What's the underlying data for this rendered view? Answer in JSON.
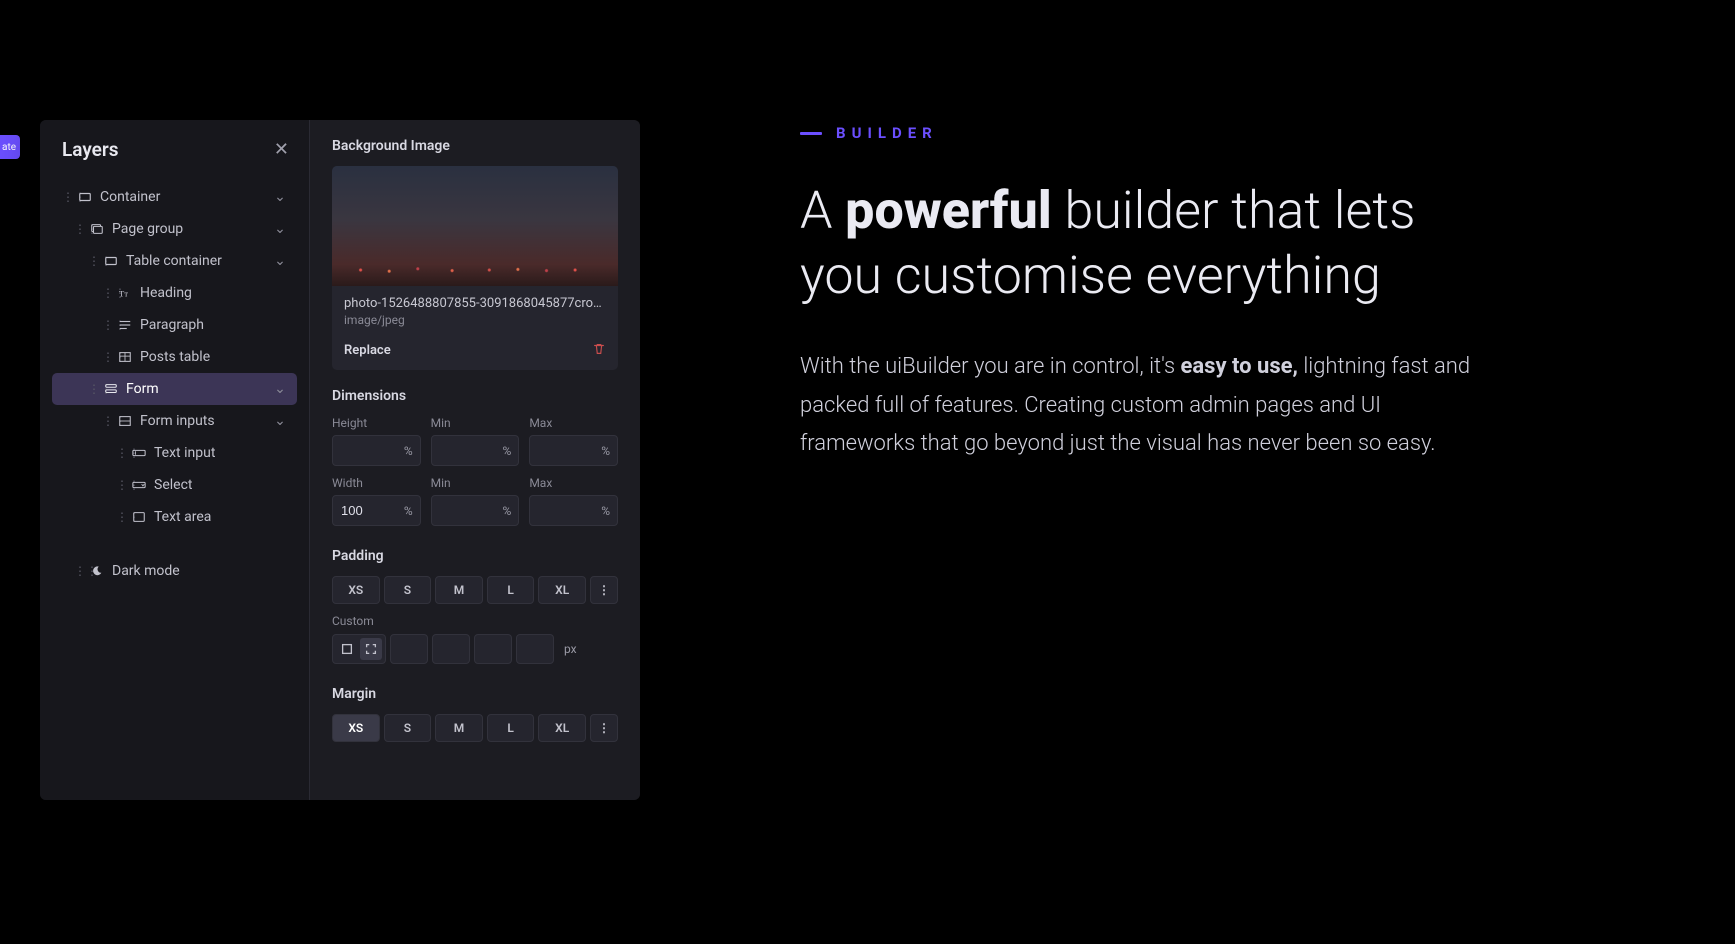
{
  "edge_button": {
    "label": "ate"
  },
  "layers": {
    "title": "Layers",
    "tree": {
      "container": "Container",
      "page_group": "Page group",
      "table_container": "Table container",
      "heading": "Heading",
      "paragraph": "Paragraph",
      "posts_table": "Posts table",
      "form": "Form",
      "form_inputs": "Form inputs",
      "text_input": "Text input",
      "select": "Select",
      "text_area": "Text area",
      "dark_mode": "Dark mode"
    }
  },
  "props": {
    "bg_image": {
      "title": "Background Image",
      "filename": "photo-1526488807855-3091868045877cro…",
      "mime": "image/jpeg",
      "replace": "Replace"
    },
    "dimensions": {
      "title": "Dimensions",
      "height_label": "Height",
      "min_label": "Min",
      "max_label": "Max",
      "width_label": "Width",
      "height_value": "",
      "height_min": "",
      "height_max": "",
      "width_value": "100",
      "width_min": "",
      "width_max": "",
      "unit": "%"
    },
    "padding": {
      "title": "Padding",
      "xs": "XS",
      "s": "S",
      "m": "M",
      "l": "L",
      "xl": "XL",
      "custom_label": "Custom",
      "px": "px"
    },
    "margin": {
      "title": "Margin",
      "xs": "XS",
      "s": "S",
      "m": "M",
      "l": "L",
      "xl": "XL"
    }
  },
  "marketing": {
    "eyebrow": "BUILDER",
    "heading_prefix": "A ",
    "heading_bold": "powerful",
    "heading_rest": " builder that lets you customise everything",
    "body_1": "With the uiBuilder you are in control, it's ",
    "body_bold": "easy to use,",
    "body_2": " lightning fast and packed full of features. Creating custom admin pages and UI frameworks that go beyond just the visual has never been so easy."
  }
}
